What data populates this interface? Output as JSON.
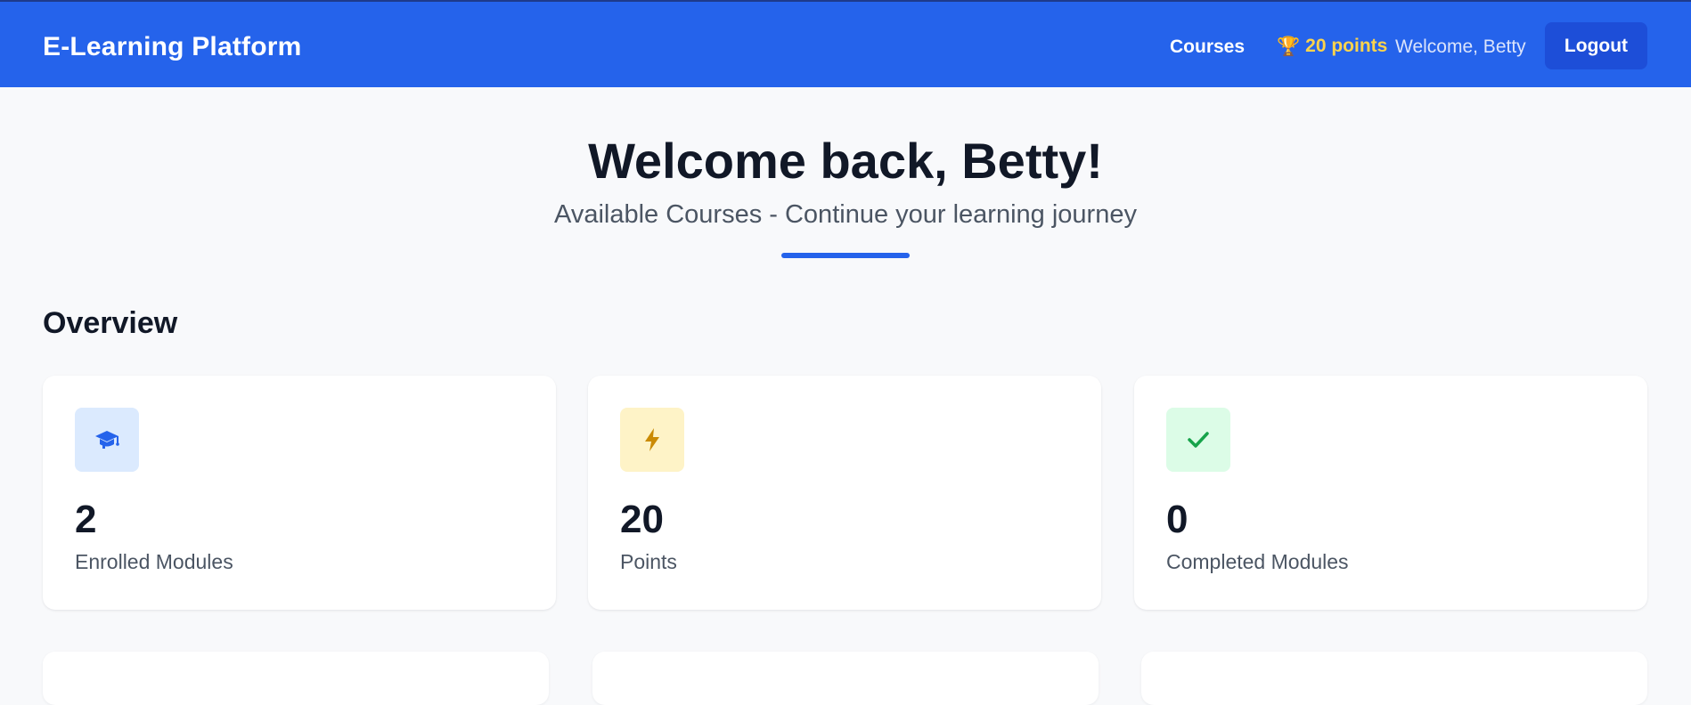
{
  "header": {
    "brand": "E-Learning Platform",
    "nav_courses": "Courses",
    "trophy_icon": "🏆",
    "points_label": "20 points",
    "welcome": "Welcome, Betty",
    "logout_label": "Logout"
  },
  "hero": {
    "title": "Welcome back, Betty!",
    "subtitle": "Available Courses - Continue your learning journey"
  },
  "overview": {
    "title": "Overview",
    "stats": [
      {
        "value": "2",
        "label": "Enrolled Modules",
        "icon": "graduation-cap-icon",
        "icon_bg": "#dbeafe",
        "icon_color": "#2563eb"
      },
      {
        "value": "20",
        "label": "Points",
        "icon": "lightning-bolt-icon",
        "icon_bg": "#fef3c7",
        "icon_color": "#ca8a04"
      },
      {
        "value": "0",
        "label": "Completed Modules",
        "icon": "checkmark-icon",
        "icon_bg": "#dcfce7",
        "icon_color": "#16a34a"
      }
    ]
  },
  "colors": {
    "primary": "#2563eb",
    "primary_dark": "#1d4ed8",
    "points_yellow": "#fcd34d",
    "background": "#f8f9fb"
  }
}
